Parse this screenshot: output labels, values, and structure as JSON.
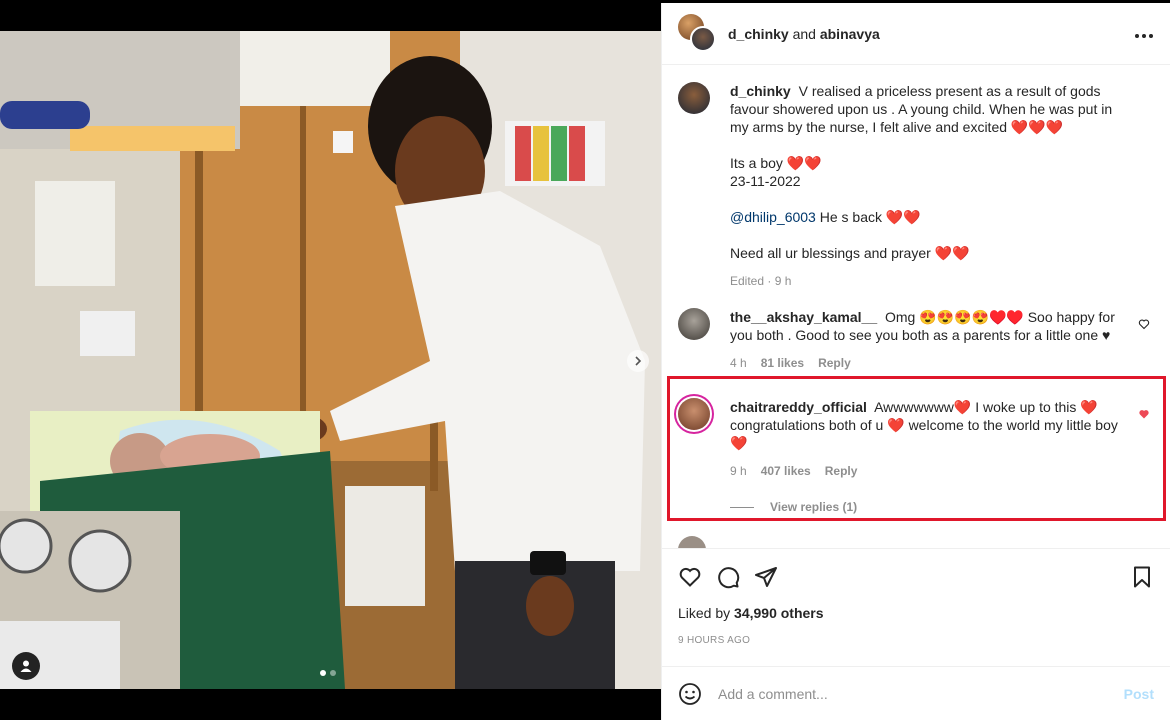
{
  "header": {
    "user1": "d_chinky",
    "conjunction": "and",
    "user2": "abinavya",
    "more_icon": "more-horizontal-icon"
  },
  "caption": {
    "username": "d_chinky",
    "text": "V realised a priceless present as a result of gods favour showered upon us . A young child. When he was put in my arms by the nurse, I felt alive and excited",
    "hearts1": "❤️❤️❤️",
    "line2": "Its a boy",
    "hearts2": "❤️❤️",
    "date": "23-11-2022",
    "mention": "@dhilip_6003",
    "mention_text": "He s back",
    "hearts3": "❤️❤️",
    "line4": "Need all ur blessings and prayer",
    "hearts4": "❤️❤️",
    "edited": "Edited · 9 h"
  },
  "comments": [
    {
      "username": "the__akshay_kamal__",
      "text": "Omg 😍😍😍😍♥️♥️ Soo happy for you both . Good to see you both as a parents for a little one ♥",
      "time": "4 h",
      "likes": "81 likes",
      "reply": "Reply"
    },
    {
      "username": "chaitrareddy_official",
      "text_a": "Awwwwwww",
      "text_b": "I woke up to this",
      "text_c": "congratulations both of u",
      "text_d": "welcome to the world my little boy",
      "heart": "❤️",
      "time": "9 h",
      "likes": "407 likes",
      "reply": "Reply",
      "view_replies": "View replies (1)"
    }
  ],
  "actions": {
    "liked_by": "Liked by",
    "liked_count": "34,990 others",
    "time_ago": "9 HOURS AGO"
  },
  "add_comment": {
    "placeholder": "Add a comment...",
    "post": "Post"
  },
  "colors": {
    "highlight": "#e0172b",
    "heart": "#ed4956",
    "link": "#00376b",
    "post_disabled": "#b2dffc"
  }
}
